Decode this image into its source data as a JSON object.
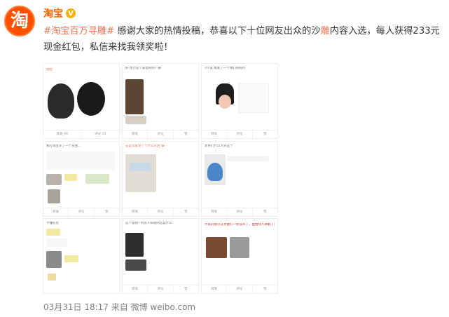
{
  "post": {
    "author": "淘宝",
    "avatar_glyph": "淘",
    "verified_glyph": "V",
    "topic": "#淘宝百万寻雕#",
    "text_a": " 感谢大家的热情投稿，恭喜以下十位网友出众的沙",
    "text_highlight": "雕",
    "text_b": "内容入选，每人获得233元现金红包，私信来找我领奖啦！",
    "meta": "03月31日 18:17 来自 微博 weibo.com"
  },
  "grid": {
    "cells": [
      {
        "caption": "哈哈",
        "bar": [
          "转发 99",
          "评论 35",
          "赞"
        ]
      },
      {
        "caption": "好 估计是个靠谱的吧? 😂",
        "bar": [
          "转发",
          "评论",
          "赞"
        ]
      },
      {
        "caption": "小Y说 我发了一个你们的照片",
        "bar": [
          "转发",
          "评论",
          "赞"
        ]
      },
      {
        "caption": "我在淘宝买了一个东西…",
        "bar": [
          "转发",
          "评论",
          "赞"
        ]
      },
      {
        "caption": "这是卖家发了个什么东西 😂",
        "bar": [
          "转发",
          "评论",
          "赞"
        ]
      },
      {
        "caption": "老乡们什么人买这个",
        "bar": [
          "转发",
          "评论",
          "赞"
        ]
      },
      {
        "caption": "不懂礼仪",
        "bar": [
          "转发",
          "评论",
          "赞"
        ]
      },
      {
        "caption": "这个是啥? 有没人知道的这是什么",
        "bar": [
          "转发",
          "评论",
          "赞"
        ]
      },
      {
        "caption": "节省的我可以为我们一把双开了，直接找人讲解了!",
        "bar": [
          "转发",
          "评论",
          "赞"
        ]
      }
    ]
  },
  "colors": {
    "brand": "#ff5000",
    "accent": "#eb7350",
    "meta": "#808080"
  }
}
